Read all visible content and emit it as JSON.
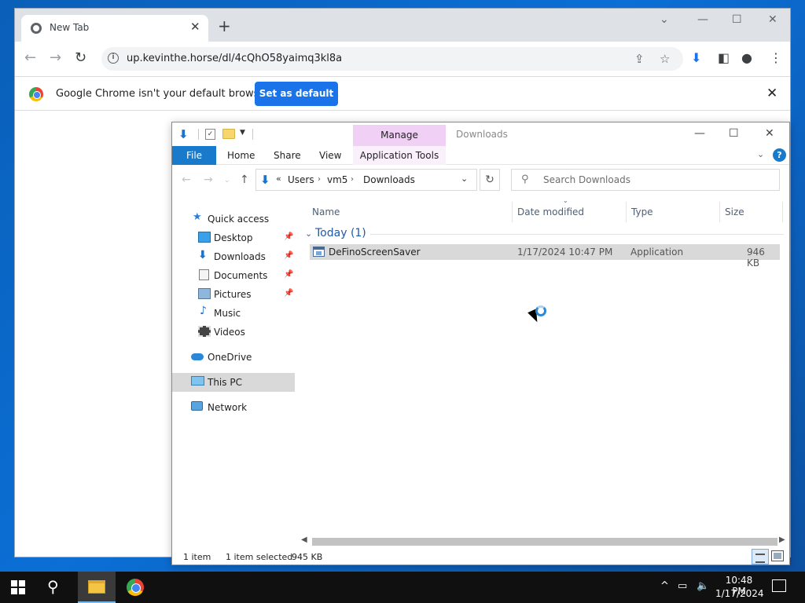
{
  "browser": {
    "tab_title": "New Tab",
    "url": "up.kevinthe.horse/dl/4cQhO58yaimq3kl8a",
    "infobar_message": "Google Chrome isn't your default browser",
    "set_default_label": "Set as default"
  },
  "explorer": {
    "title": "Downloads",
    "manage_tab": "Manage",
    "ribbon": {
      "file": "File",
      "home": "Home",
      "share": "Share",
      "view": "View",
      "app_tools": "Application Tools"
    },
    "breadcrumb": [
      "Users",
      "vm5",
      "Downloads"
    ],
    "search_placeholder": "Search Downloads",
    "nav": {
      "quick_access": "Quick access",
      "desktop": "Desktop",
      "downloads": "Downloads",
      "documents": "Documents",
      "pictures": "Pictures",
      "music": "Music",
      "videos": "Videos",
      "onedrive": "OneDrive",
      "this_pc": "This PC",
      "network": "Network"
    },
    "columns": {
      "name": "Name",
      "date": "Date modified",
      "type": "Type",
      "size": "Size"
    },
    "group": "Today (1)",
    "files": [
      {
        "name": "DeFinoScreenSaver",
        "date": "1/17/2024 10:47 PM",
        "type": "Application",
        "size": "946 KB"
      }
    ],
    "status": {
      "count": "1 item",
      "selected": "1 item selected",
      "selected_size": "945 KB"
    }
  },
  "taskbar": {
    "time": "10:48 PM",
    "date": "1/17/2024"
  },
  "colors": {
    "accent": "#1a73e8",
    "file_tab": "#1979ca",
    "manage": "#f0d0f5",
    "desktop": "#0b6fd6"
  }
}
